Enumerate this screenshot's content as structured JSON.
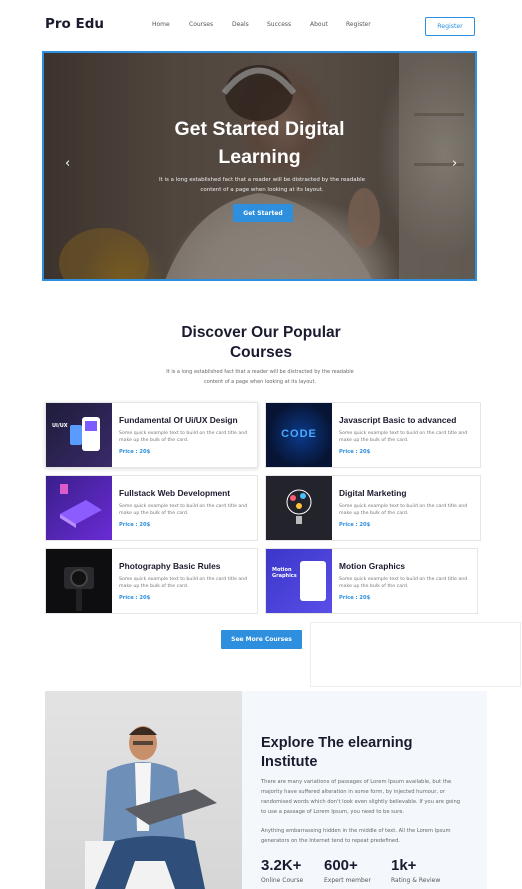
{
  "nav": {
    "logo": "Pro Edu",
    "items": [
      "Home",
      "Courses",
      "Deals",
      "Success",
      "About",
      "Register"
    ],
    "register_button": "Register"
  },
  "hero": {
    "title_line1": "Get Started Digital",
    "title_line2": "Learning",
    "text_line1": "It is a long established fact that a reader will be distracted by the readable",
    "text_line2": "content of a page when looking at its layout.",
    "cta": "Get Started",
    "prev_icon": "chevron-left-icon",
    "next_icon": "chevron-right-icon"
  },
  "courses": {
    "title_line1": "Discover Our Popular",
    "title_line2": "Courses",
    "subtitle_line1": "It is a long established fact that a reader will be distracted by the readable",
    "subtitle_line2": "content of a page when looking at its layout.",
    "items": [
      {
        "title": "Fundamental Of Ui/UX Design",
        "desc": "Some quick example text to build on the card title and make up the bulk of the card.",
        "price": "Price : 20$",
        "thumb_text": "UI/UX"
      },
      {
        "title": "Javascript Basic to advanced",
        "desc": "Some quick example text to build on the card title and make up the bulk of the card.",
        "price": "Price : 20$",
        "thumb_text": "CODE"
      },
      {
        "title": "Fullstack Web Development",
        "desc": "Some quick example text to build on the card title and make up the bulk of the card.",
        "price": "Price : 20$",
        "thumb_text": ""
      },
      {
        "title": "Digital Marketing",
        "desc": "Some quick example text to build on the card title and make up the bulk of the card.",
        "price": "Price : 20$",
        "thumb_text": ""
      },
      {
        "title": "Photography Basic Rules",
        "desc": "Some quick example text to build on the card title and make up the bulk of the card.",
        "price": "Price : 20$",
        "thumb_text": ""
      },
      {
        "title": "Motion Graphics",
        "desc": "Some quick example text to build on the card title and make up the bulk of the card.",
        "price": "Price : 20$",
        "thumb_text": "Motion Graphics"
      }
    ],
    "see_more": "See More Courses"
  },
  "about": {
    "title_line1": "Explore The elearning",
    "title_line2": "Institute",
    "para1": "There are many variations of passages of Lorem Ipsum available, but the majority have suffered alteration in some form, by injected humour, or randomised words which don't look even slightly believable. If you are going to use a passage of Lorem Ipsum, you need to be sure.",
    "para2": "Anything embarrassing hidden in the middle of text. All the Lorem Ipsum generators on the Internet tend to repeat predefined.",
    "stats": [
      {
        "value": "3.2K+",
        "label": "Online Course"
      },
      {
        "value": "600+",
        "label": "Expert member"
      },
      {
        "value": "1k+",
        "label": "Rating & Review"
      }
    ]
  },
  "colors": {
    "accent": "#2e8fdf",
    "dark": "#1b1b2f"
  }
}
